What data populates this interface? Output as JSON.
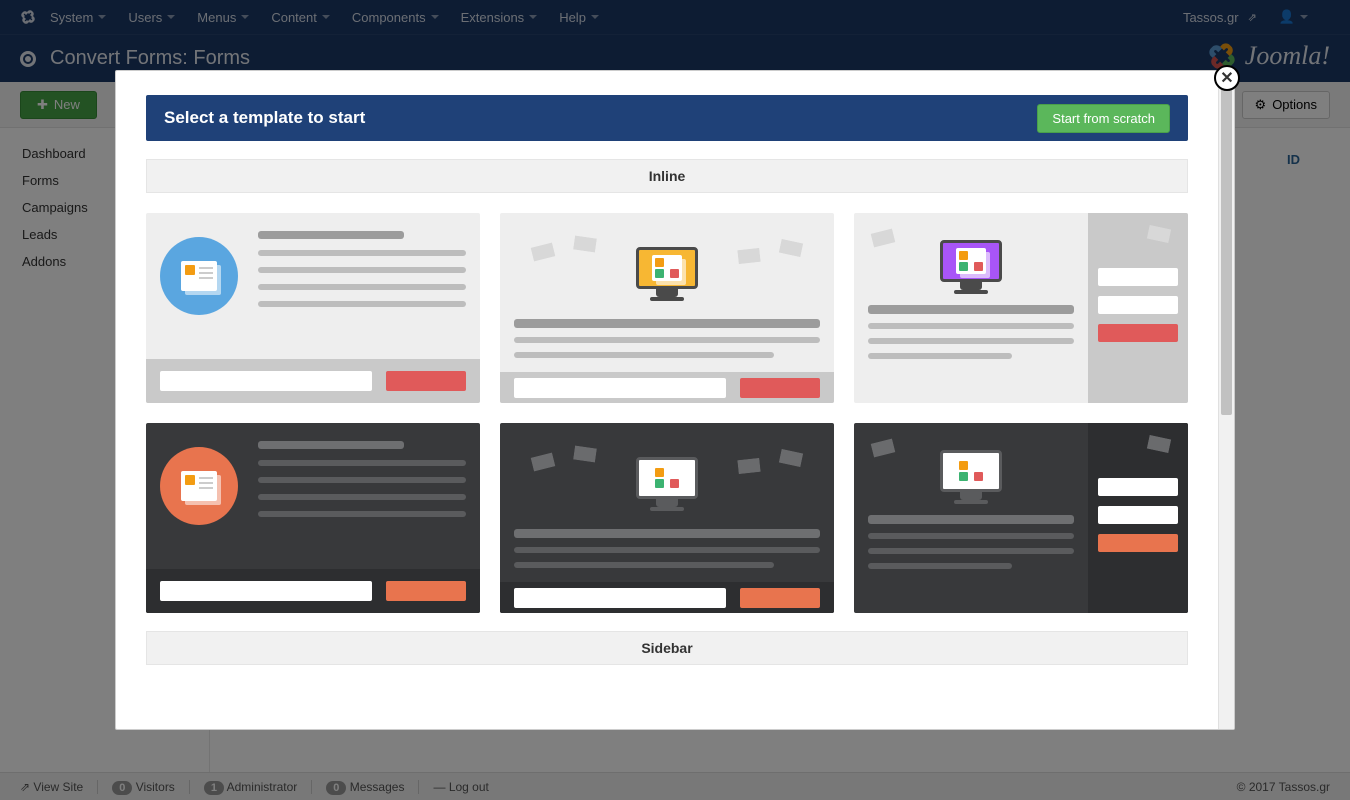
{
  "topnav": {
    "items": [
      "System",
      "Users",
      "Menus",
      "Content",
      "Components",
      "Extensions",
      "Help"
    ],
    "site_link": "Tassos.gr"
  },
  "titlebar": {
    "title": "Convert Forms: Forms",
    "brand": "Joomla!"
  },
  "toolbar": {
    "new": "New",
    "options": "Options"
  },
  "sidebar": {
    "items": [
      "Dashboard",
      "Forms",
      "Campaigns",
      "Leads",
      "Addons"
    ]
  },
  "table": {
    "id_col": "ID"
  },
  "footer": {
    "view_site": "View Site",
    "visitors_count": "0",
    "visitors": "Visitors",
    "admin_count": "1",
    "admin": "Administrator",
    "messages_count": "0",
    "messages": "Messages",
    "logout": "Log out",
    "copyright": "© 2017 Tassos.gr"
  },
  "modal": {
    "title": "Select a template to start",
    "start": "Start from scratch",
    "sections": {
      "inline": "Inline",
      "sidebar": "Sidebar"
    }
  },
  "colors": {
    "topnav_bg": "#1a3867",
    "modal_header": "#1f4178",
    "success": "#5bb75b",
    "accent_red": "#e05a5a",
    "accent_orange": "#e8744e",
    "card_light": "#eeeeee",
    "card_dark": "#38393b"
  }
}
